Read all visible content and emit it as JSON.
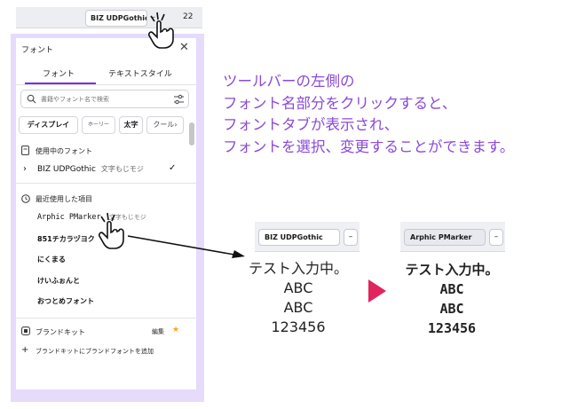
{
  "toolbar": {
    "font_name": "BIZ UDPGothic",
    "minus": "–",
    "font_size": "22"
  },
  "panel": {
    "title": "フォント",
    "tabs": [
      {
        "label": "フォント"
      },
      {
        "label": "テキストスタイル"
      }
    ],
    "search": {
      "placeholder": "書籍やフォント名で検索"
    },
    "chips": [
      "ディスプレイ",
      "ホーリー",
      "太字",
      "クール"
    ],
    "chip_next": "›",
    "in_use": {
      "heading": "使用中のフォント",
      "expand": "›",
      "font": "BIZ UDPGothic",
      "sample": "文字もじモジ",
      "check": "✓"
    },
    "recent": {
      "heading": "最近使用した項目",
      "items": [
        {
          "name": "Arphic PMarker",
          "sample": "文字もじモジ"
        },
        {
          "name": "851チカラヅヨク"
        },
        {
          "name": "にくまる"
        },
        {
          "name": "けいふぉんと"
        },
        {
          "name": "おつとめフォント"
        }
      ]
    },
    "brand": {
      "heading": "ブランドキット",
      "edit": "編集",
      "add": "ブランドキットにブランドフォントを追加",
      "plus": "+"
    }
  },
  "instruction": {
    "lines": [
      "ツールバーの左側の",
      "フォント名部分をクリックすると、",
      "フォントタブが表示され、",
      "フォントを選択、変更することができます。"
    ]
  },
  "preview_before": {
    "font_name": "BIZ UDPGothic",
    "button": "–",
    "lines": [
      "テスト入力中。",
      "ABC",
      "ABC",
      "123456"
    ]
  },
  "preview_after": {
    "font_name": "Arphic PMarker",
    "button": "–",
    "lines": [
      "テスト入力中。",
      "ABC",
      "ABC",
      "123456"
    ]
  },
  "colors": {
    "accent": "#7d2ae8",
    "instruction": "#8a4ad8",
    "arrow": "#e0245e",
    "frame": "#e6dbfa",
    "star": "#f5a623"
  }
}
